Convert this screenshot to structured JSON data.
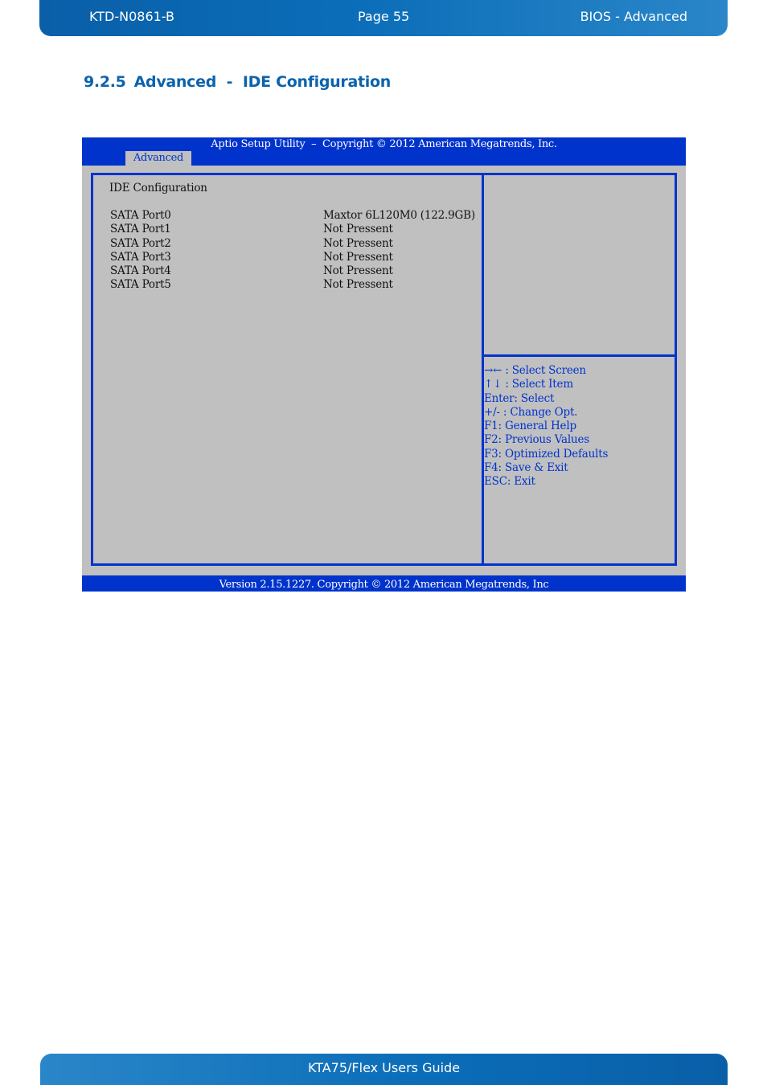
{
  "header": {
    "doc_id": "KTD-N0861-B",
    "page": "Page 55",
    "section": "BIOS  - Advanced"
  },
  "section_title": {
    "number": "9.2.5",
    "text": "Advanced  -  IDE Configuration"
  },
  "bios": {
    "title": "Aptio Setup Utility  –  Copyright © 2012 American Megatrends, Inc.",
    "active_tab": "Advanced",
    "screen_title": "IDE Configuration",
    "ports": [
      {
        "label": "SATA Port0",
        "value": "Maxtor 6L120M0 (122.9GB)"
      },
      {
        "label": "SATA Port1",
        "value": "Not Pressent"
      },
      {
        "label": "SATA Port2",
        "value": "Not Pressent"
      },
      {
        "label": "SATA Port3",
        "value": "Not Pressent"
      },
      {
        "label": "SATA Port4",
        "value": "Not Pressent"
      },
      {
        "label": "SATA Port5",
        "value": "Not Pressent"
      }
    ],
    "help": [
      "→← : Select Screen",
      "↑↓ : Select Item",
      "Enter: Select",
      "+/- : Change Opt.",
      "F1: General Help",
      "F2: Previous Values",
      "F3: Optimized Defaults",
      "F4: Save & Exit",
      "ESC: Exit"
    ],
    "version": "Version 2.15.1227. Copyright © 2012 American Megatrends, Inc",
    "colors": {
      "bar_blue": "#0033cc",
      "panel_gray": "#c0c0c0",
      "help_text": "#0033cc"
    }
  },
  "footer": {
    "guide_title": "KTA75/Flex Users Guide"
  }
}
